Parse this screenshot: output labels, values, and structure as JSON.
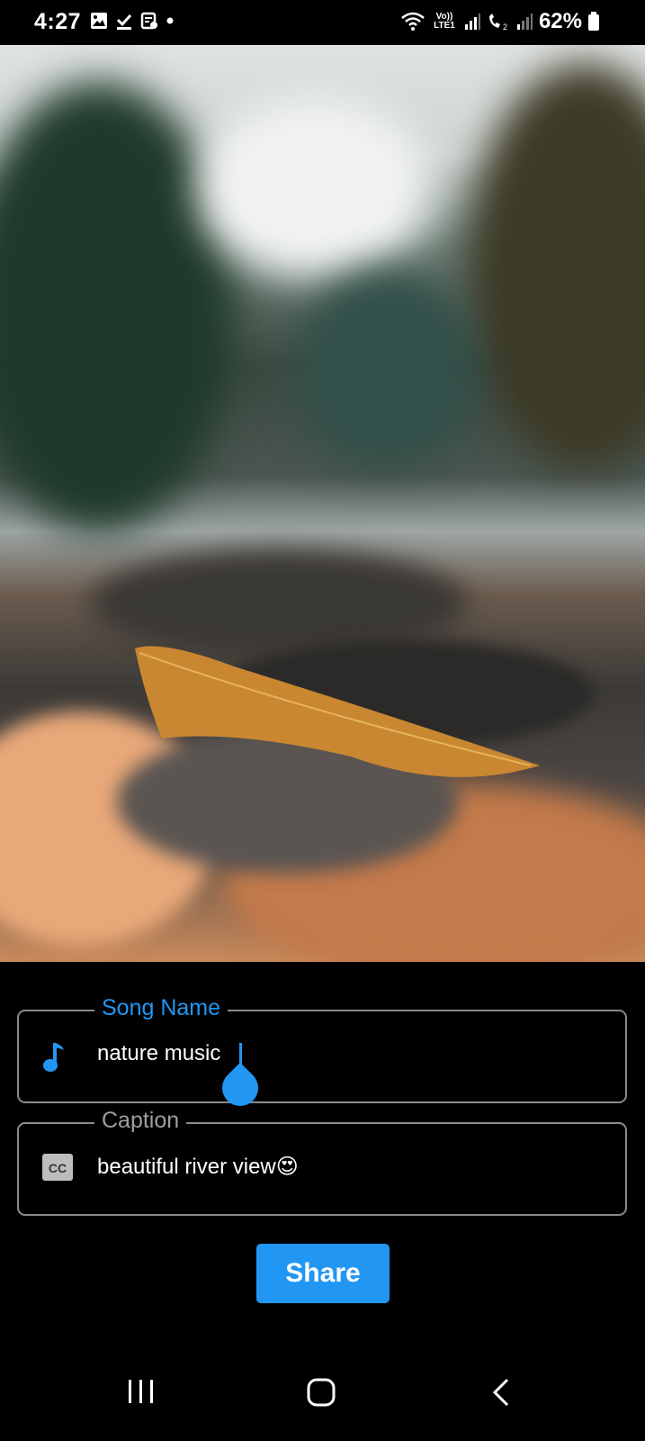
{
  "status_bar": {
    "time": "4:27",
    "battery": "62%",
    "net_label": "Vo)) LTE1"
  },
  "form": {
    "song_label": "Song Name",
    "song_value": "nature music",
    "caption_label": "Caption",
    "caption_value": "beautiful river view😍",
    "share_label": "Share"
  },
  "colors": {
    "accent": "#2196f3",
    "field_border": "#8a8a8a",
    "background": "#000000"
  },
  "icons": {
    "song": "music-note-icon",
    "caption": "closed-caption-icon"
  }
}
